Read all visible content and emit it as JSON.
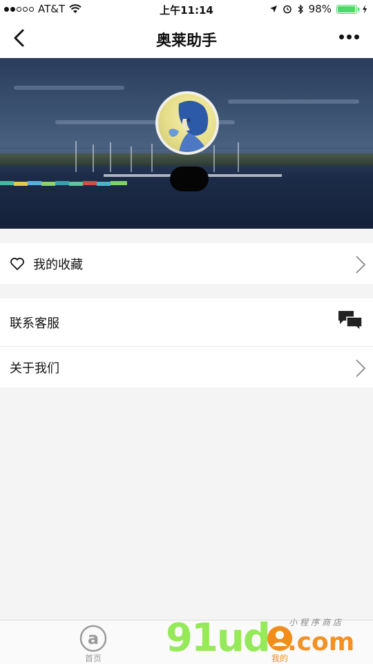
{
  "status_bar": {
    "carrier": "AT&T",
    "time": "上午11:14",
    "battery_percent": "98%",
    "battery_level": 0.98,
    "signal_bars": 2
  },
  "nav": {
    "title": "奥莱助手",
    "back_icon": "chevron-left-icon",
    "more_icon": "more-dots-icon"
  },
  "profile": {
    "avatar_icon": "avatar-photo"
  },
  "menu_groups": [
    {
      "items": [
        {
          "label": "我的收藏",
          "icon": "heart-icon",
          "trailing": "chevron-right-icon"
        }
      ]
    },
    {
      "items": [
        {
          "label": "联系客服",
          "trailing": "chat-bubbles-icon"
        },
        {
          "label": "关于我们",
          "trailing": "chevron-right-icon"
        }
      ]
    }
  ],
  "tab_bar": {
    "tabs": [
      {
        "label": "首页",
        "icon": "at-sign-icon",
        "active": false
      },
      {
        "label": "我的",
        "icon": "user-icon",
        "active": true
      }
    ],
    "active_color": "#f28c1a",
    "inactive_color": "#999999"
  },
  "watermark": {
    "brand": "91ud",
    "domain": ".com",
    "tagline": "小程序商店"
  },
  "colors": {
    "battery": "#4cd964",
    "accent": "#f28c1a",
    "watermark_green": "#8ee84b"
  }
}
